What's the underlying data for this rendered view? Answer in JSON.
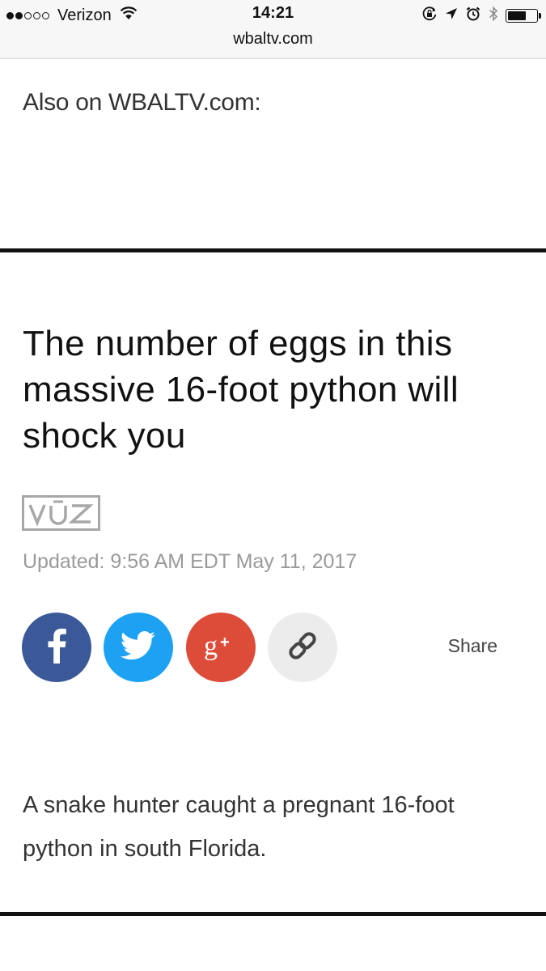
{
  "status_bar": {
    "carrier": "Verizon",
    "time": "14:21",
    "url": "wbaltv.com",
    "signal_bars_filled": 2,
    "signal_bars_total": 5,
    "battery_level": 0.65
  },
  "also_on": {
    "text": "Also on WBALTV.com:"
  },
  "article": {
    "headline": "The number of eggs in this massive 16-foot python will shock you",
    "source_logo_text": "VŪZ",
    "updated": "Updated: 9:56 AM EDT May 11, 2017",
    "body": "A snake hunter caught a pregnant 16-foot python in south Florida."
  },
  "share": {
    "label": "Share",
    "buttons": [
      {
        "icon": "facebook-icon",
        "color": "#3b5998"
      },
      {
        "icon": "twitter-icon",
        "color": "#1da1f2"
      },
      {
        "icon": "google-plus-icon",
        "color": "#dd4b39"
      },
      {
        "icon": "link-icon",
        "color": "#ececec"
      }
    ]
  }
}
